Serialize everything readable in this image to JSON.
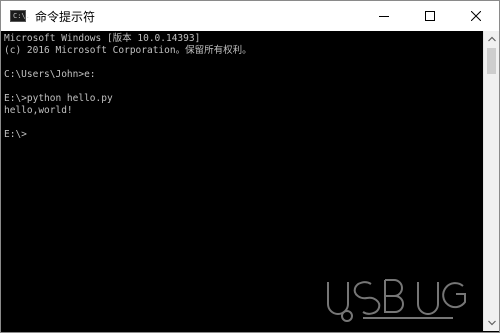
{
  "window": {
    "title": "命令提示符",
    "icon": "cmd-icon",
    "icon_text": "C:\\."
  },
  "controls": {
    "minimize_icon": "minimize-icon",
    "maximize_icon": "maximize-icon",
    "close_icon": "close-icon"
  },
  "console": {
    "lines": [
      "Microsoft Windows [版本 10.0.14393]",
      "(c) 2016 Microsoft Corporation。保留所有权利。",
      "",
      "C:\\Users\\John>e:",
      "",
      "E:\\>python hello.py",
      "hello,world!",
      "",
      "E:\\>"
    ]
  },
  "colors": {
    "console_background": "#000000",
    "console_text": "#c0c0c0",
    "titlebar_background": "#ffffff"
  }
}
